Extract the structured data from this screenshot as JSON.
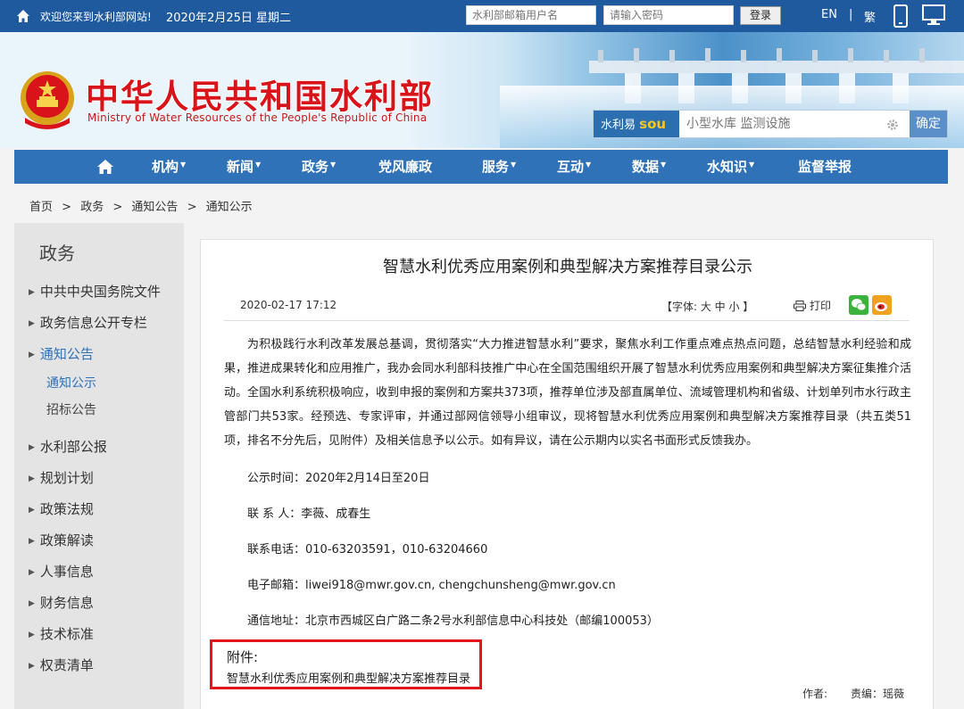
{
  "topbar": {
    "welcome": "欢迎您来到水利部网站!",
    "date": "2020年2月25日 星期二",
    "user_placeholder": "水利部邮箱用户名",
    "password_placeholder": "请输入密码",
    "login_label": "登录",
    "lang_en": "EN",
    "separator": "|",
    "lang_tw": "繁"
  },
  "header": {
    "cn_title": "中华人民共和国水利部",
    "en_title": "Ministry of Water Resources of the People's Republic of China",
    "search_brand_prefix": "水利易",
    "search_brand_s": "s",
    "search_brand_o": "o",
    "search_brand_u": "u",
    "search_placeholder": "小型水库 监测设施",
    "search_button": "确定"
  },
  "nav": {
    "items": [
      {
        "label": "机构",
        "caret": "▼"
      },
      {
        "label": "新闻",
        "caret": "▼"
      },
      {
        "label": "政务",
        "caret": "▼"
      },
      {
        "label": "党风廉政",
        "caret": ""
      },
      {
        "label": "服务",
        "caret": "▼"
      },
      {
        "label": "互动",
        "caret": "▼"
      },
      {
        "label": "数据",
        "caret": "▼"
      },
      {
        "label": "水知识",
        "caret": "▼"
      },
      {
        "label": "监督举报",
        "caret": ""
      }
    ]
  },
  "breadcrumb": {
    "items": [
      "首页",
      ">",
      "政务",
      ">",
      "通知公告",
      ">",
      "通知公示"
    ]
  },
  "sidebar": {
    "title": "政务",
    "marker": "▶",
    "items": [
      "中共中央国务院文件",
      "政务信息公开专栏",
      "通知公告",
      "水利部公报",
      "规划计划",
      "政策法规",
      "政策解读",
      "人事信息",
      "财务信息",
      "技术标准",
      "权责清单"
    ],
    "subitems": [
      "通知公示",
      "招标公告"
    ]
  },
  "article": {
    "title": "智慧水利优秀应用案例和典型解决方案推荐目录公示",
    "date": "2020-02-17 17:12",
    "font_control": "【字体:  大  中  小 】",
    "print_label": "打印",
    "body": "为积极践行水利改革发展总基调，贯彻落实“大力推进智慧水利”要求，聚焦水利工作重点难点热点问题，总结智慧水利经验和成果，推进成果转化和应用推广，我办会同水利部科技推广中心在全国范围组织开展了智慧水利优秀应用案例和典型解决方案征集推介活动。全国水利系统积极响应，收到申报的案例和方案共373项，推荐单位涉及部直属单位、流域管理机构和省级、计划单列市水行政主管部门共53家。经预选、专家评审，并通过部网信领导小组审议，现将智慧水利优秀应用案例和典型解决方案推荐目录（共五类51项，排名不分先后，见附件）及相关信息予以公示。如有异议，请在公示期内以实名书面形式反馈我办。",
    "period": "公示时间：2020年2月14日至20日",
    "contact": "联 系 人：李薇、成春生",
    "phone": "联系电话：010-63203591，010-63204660",
    "email": "电子邮箱：liwei918@mwr.gov.cn, chengchunsheng@mwr.gov.cn",
    "address": "通信地址：北京市西城区白广路二条2号水利部信息中心科技处（邮编100053）",
    "attachment_label": "附件:",
    "attachment_link": "智慧水利优秀应用案例和典型解决方案推荐目录",
    "author": "作者:",
    "editor": "责编：瑶薇"
  },
  "colors": {
    "topbar": "#1f5a9e",
    "nav": "#2f72b8",
    "title_red": "#d8141a",
    "highlight_box": "#e0161c"
  }
}
